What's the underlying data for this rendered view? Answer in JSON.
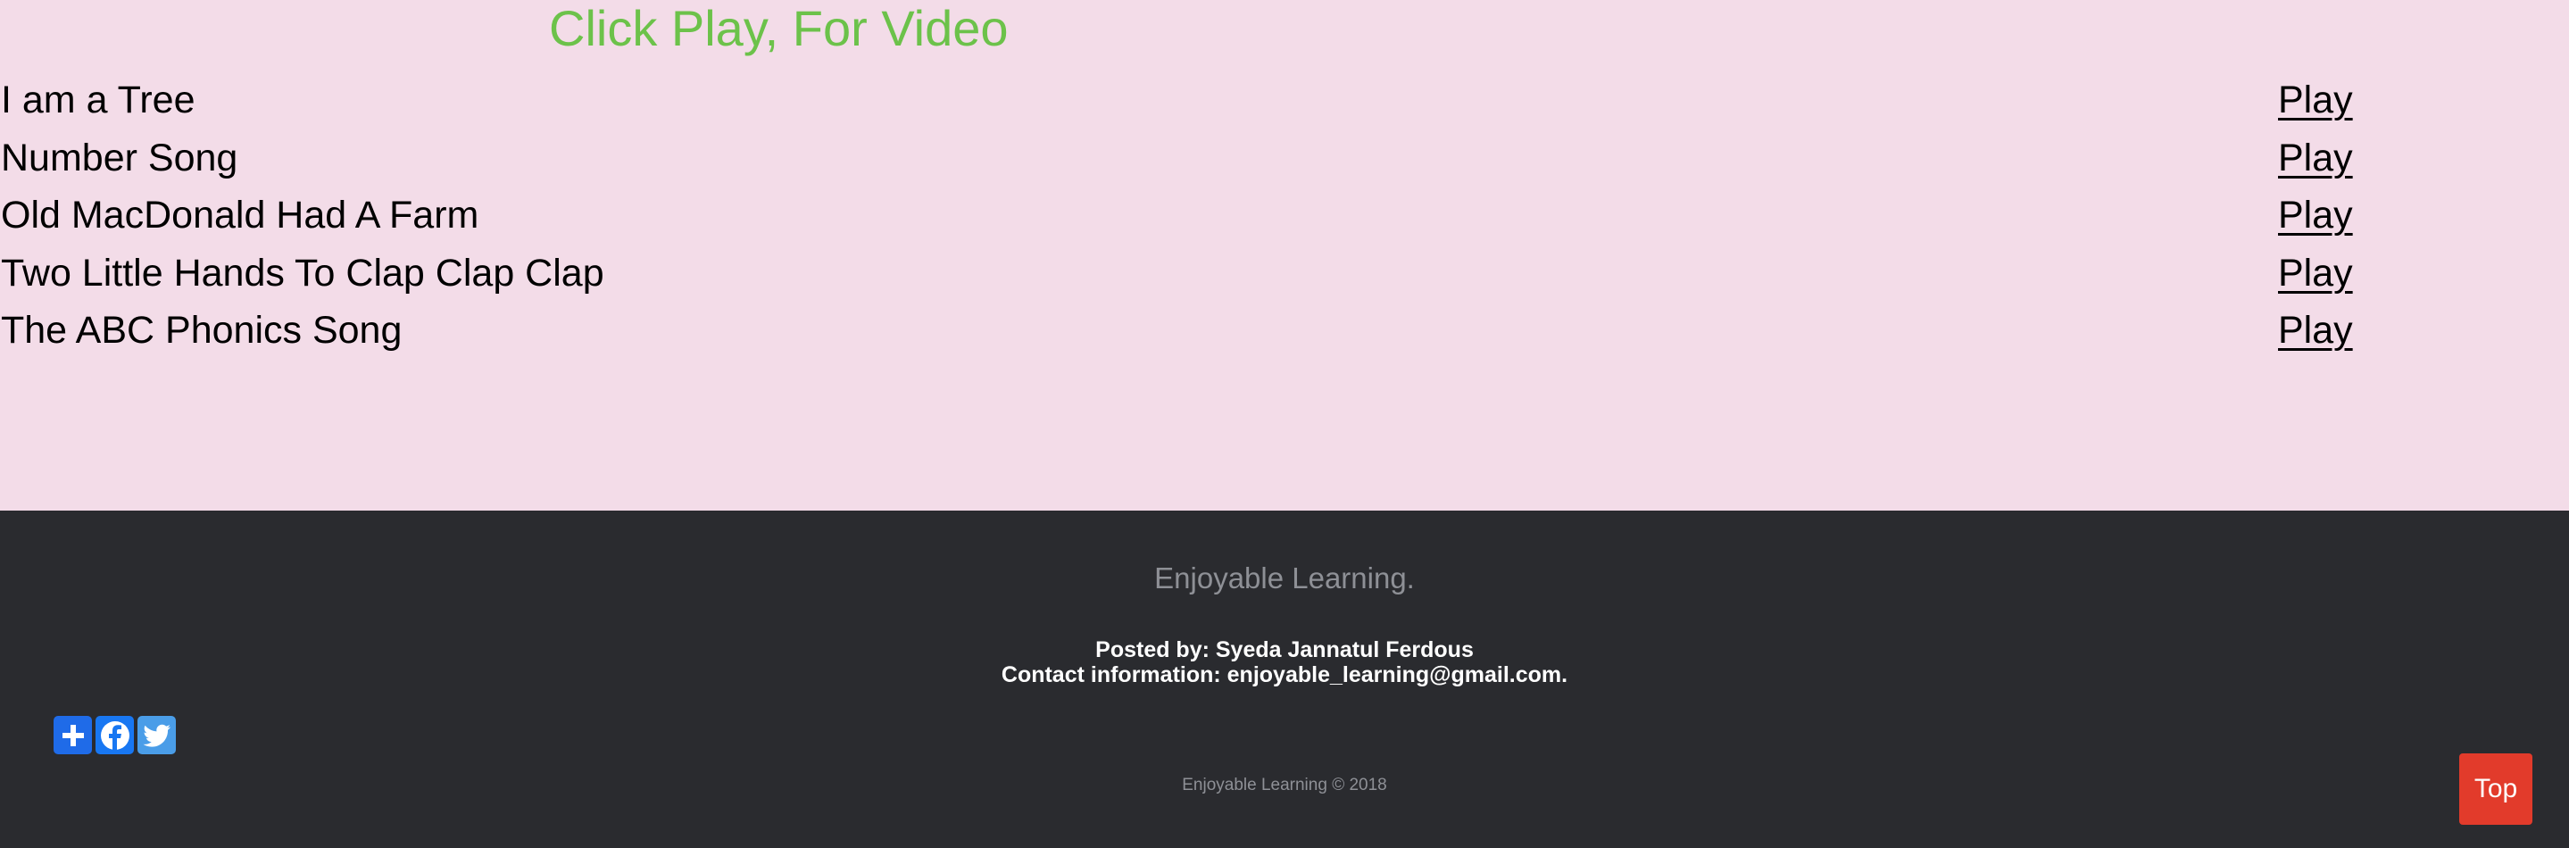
{
  "main": {
    "heading": "Click Play, For Video",
    "songs": [
      {
        "title": "I am a Tree",
        "play_label": "Play"
      },
      {
        "title": "Number Song",
        "play_label": "Play"
      },
      {
        "title": "Old MacDonald Had A Farm",
        "play_label": "Play"
      },
      {
        "title": "Two Little Hands To Clap Clap Clap",
        "play_label": "Play"
      },
      {
        "title": "The ABC Phonics Song",
        "play_label": "Play"
      }
    ]
  },
  "footer": {
    "brand": "Enjoyable Learning.",
    "posted_by": "Posted by: Syeda Jannatul Ferdous",
    "contact": "Contact information: enjoyable_learning@gmail.com.",
    "share_icons": [
      "add-icon",
      "facebook-icon",
      "twitter-icon"
    ],
    "copyright": "Enjoyable Learning © 2018"
  },
  "top_button": {
    "label": "Top"
  },
  "colors": {
    "page_bg": "#f3dce8",
    "heading": "#6cc24a",
    "footer_bg": "#2a2b2f",
    "footer_muted": "#8e9096",
    "top_button_bg": "#e23b2b"
  }
}
